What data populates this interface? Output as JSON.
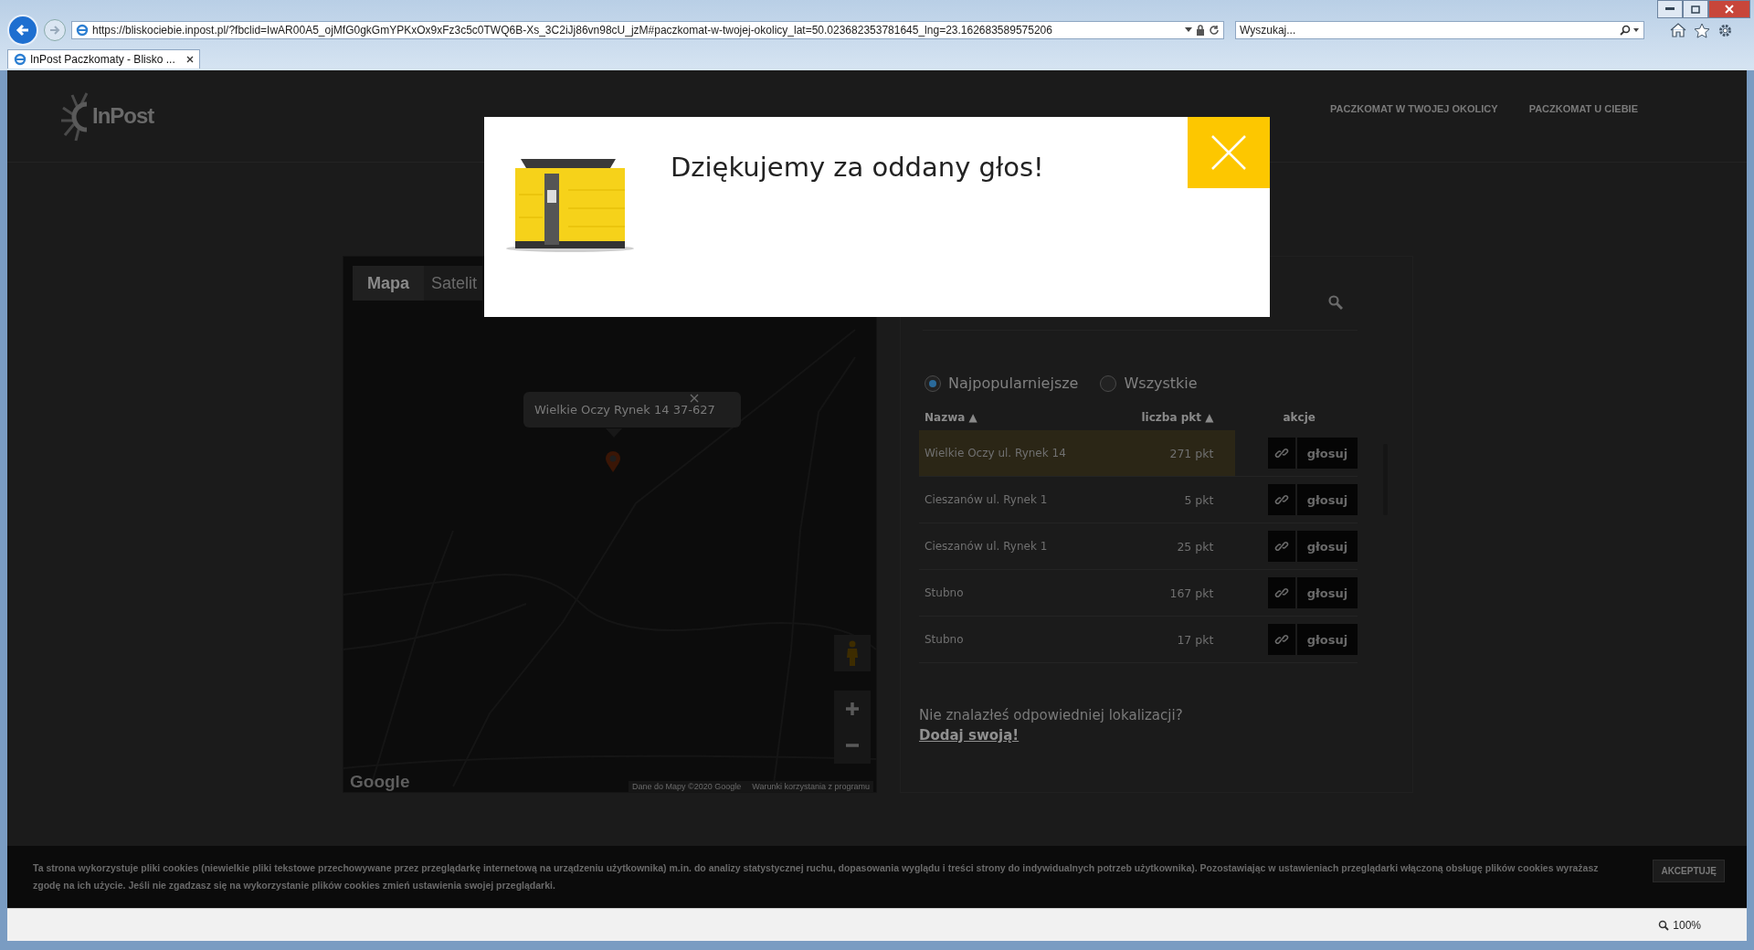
{
  "browser": {
    "url": "https://bliskociebie.inpost.pl/?fbclid=IwAR00A5_ojMfG0gkGmYPKxOx9xFz3c5c0TWQ6B-Xs_3C2iJj86vn98cU_jzM#paczkomat-w-twojej-okolicy_lat=50.023682353781645_lng=23.162683589575206",
    "search_placeholder": "Wyszukaj...",
    "tabs": [
      {
        "label": "InPost Paczkomaty - Blisko ...",
        "selected": true
      }
    ],
    "zoom": "100%"
  },
  "header": {
    "logo": "InPost",
    "nav": [
      "PACZKOMAT W TWOJEJ OKOLICY",
      "PACZKOMAT U CIEBIE"
    ]
  },
  "map": {
    "types": [
      {
        "label": "Mapa",
        "selected": true
      },
      {
        "label": "Satelit",
        "selected": false
      }
    ],
    "popup": "Wielkie Oczy Rynek 14 37-627",
    "logo": "Google",
    "attribution": "Dane do Mapy ©2020 Google",
    "terms": "Warunki korzystania z programu"
  },
  "list": {
    "filters": [
      {
        "label": "Najpopularniejsze",
        "selected": true
      },
      {
        "label": "Wszystkie",
        "selected": false
      }
    ],
    "columns": [
      "Nazwa ▲",
      "liczba pkt ▲",
      "akcje"
    ],
    "rows": [
      {
        "name": "Wielkie Oczy ul. Rynek 14",
        "points": "271 pkt",
        "vote": "głosuj",
        "selected": true
      },
      {
        "name": "Cieszanów ul. Rynek 1",
        "points": "5 pkt",
        "vote": "głosuj",
        "selected": false
      },
      {
        "name": "Cieszanów ul. Rynek 1",
        "points": "25 pkt",
        "vote": "głosuj",
        "selected": false
      },
      {
        "name": "Stubno",
        "points": "167 pkt",
        "vote": "głosuj",
        "selected": false
      },
      {
        "name": "Stubno",
        "points": "17 pkt",
        "vote": "głosuj",
        "selected": false
      }
    ],
    "prompt": "Nie znalazłeś odpowiedniej lokalizacji?",
    "link": "Dodaj swoją!"
  },
  "modal": {
    "title": "Dziękujemy za oddany głos!"
  },
  "cookie_bar": {
    "text": "Ta strona wykorzystuje pliki cookies (niewielkie pliki tekstowe przechowywane przez przeglądarkę internetową na urządzeniu użytkownika) m.in. do analizy statystycznej ruchu, dopasowania wyglądu i treści strony do indywidualnych potrzeb użytkownika). Pozostawiając w ustawieniach przeglądarki włączoną obsługę plików cookies wyrażasz zgodę na ich użycie. Jeśli nie zgadzasz się na wykorzystanie plików cookies zmień ustawienia swojej przeglądarki.",
    "button": "AKCEPTUJĘ"
  }
}
